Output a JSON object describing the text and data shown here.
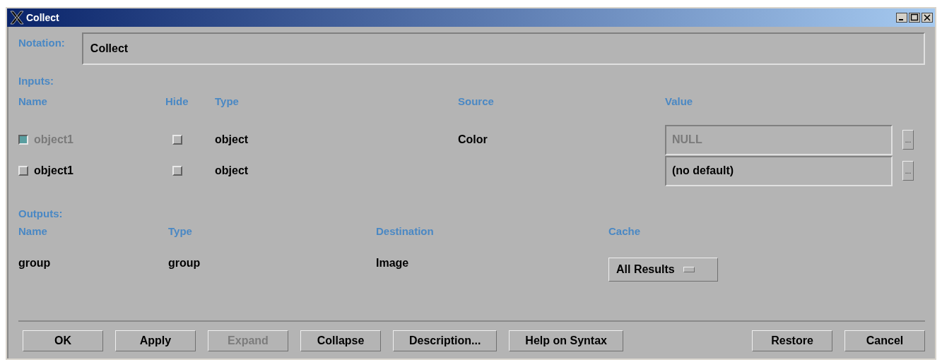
{
  "window": {
    "title": "Collect"
  },
  "notation": {
    "label": "Notation:",
    "value": "Collect"
  },
  "inputs": {
    "label": "Inputs:",
    "columns": [
      "Name",
      "Hide",
      "Type",
      "Source",
      "Value"
    ],
    "rows": [
      {
        "name": "object1",
        "disabled": true,
        "checked": true,
        "hide_checked": false,
        "type": "object",
        "source": "Color",
        "value": "NULL",
        "button": "..."
      },
      {
        "name": "object1",
        "disabled": false,
        "checked": false,
        "hide_checked": false,
        "type": "object",
        "source": "",
        "value": "(no default)",
        "button": "..."
      }
    ]
  },
  "outputs": {
    "label": "Outputs:",
    "columns": [
      "Name",
      "Type",
      "Destination",
      "Cache"
    ],
    "rows": [
      {
        "name": "group",
        "type": "group",
        "destination": "Image",
        "cache": "All Results"
      }
    ]
  },
  "buttons": [
    {
      "label": "OK",
      "disabled": false
    },
    {
      "label": "Apply",
      "disabled": false
    },
    {
      "label": "Expand",
      "disabled": true
    },
    {
      "label": "Collapse",
      "disabled": false
    },
    {
      "label": "Description...",
      "disabled": false
    },
    {
      "label": "Help on Syntax",
      "disabled": false
    },
    {
      "label": "Restore",
      "disabled": false,
      "right": true
    },
    {
      "label": "Cancel",
      "disabled": false
    }
  ]
}
